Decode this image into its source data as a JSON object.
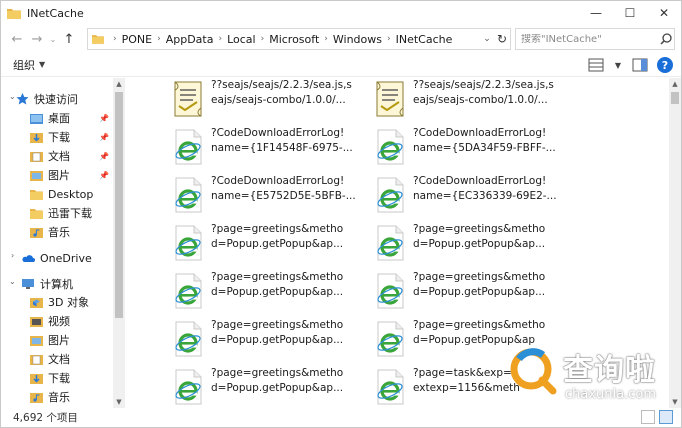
{
  "window": {
    "title": "INetCache"
  },
  "address": {
    "crumbs": [
      "PONE",
      "AppData",
      "Local",
      "Microsoft",
      "Windows",
      "INetCache"
    ]
  },
  "search": {
    "placeholder": "搜索\"INetCache\""
  },
  "toolbar": {
    "organize_label": "组织"
  },
  "nav": {
    "items": [
      {
        "label": "快速访问",
        "icon": "star-icon",
        "pinned": false
      },
      {
        "label": "桌面",
        "icon": "desktop-folder-icon",
        "pinned": true
      },
      {
        "label": "下载",
        "icon": "download-folder-icon",
        "pinned": true
      },
      {
        "label": "文档",
        "icon": "documents-folder-icon",
        "pinned": true
      },
      {
        "label": "图片",
        "icon": "pictures-folder-icon",
        "pinned": true
      },
      {
        "label": "Desktop",
        "icon": "folder-icon",
        "pinned": false
      },
      {
        "label": "迅雷下载",
        "icon": "folder-icon",
        "pinned": false
      },
      {
        "label": "音乐",
        "icon": "music-folder-icon",
        "pinned": false
      },
      {
        "label": "OneDrive",
        "icon": "cloud-icon",
        "pinned": false
      },
      {
        "label": "计算机",
        "icon": "computer-icon",
        "pinned": false
      },
      {
        "label": "3D 对象",
        "icon": "3d-objects-icon",
        "pinned": false
      },
      {
        "label": "视频",
        "icon": "videos-folder-icon",
        "pinned": false
      },
      {
        "label": "图片",
        "icon": "pictures-folder-icon",
        "pinned": false
      },
      {
        "label": "文档",
        "icon": "documents-folder-icon",
        "pinned": false
      },
      {
        "label": "下载",
        "icon": "download-folder-icon",
        "pinned": false
      },
      {
        "label": "音乐",
        "icon": "music-folder-icon",
        "pinned": false
      }
    ]
  },
  "files": [
    {
      "name": "??seajs/seajs/2.2.3/sea.js,s\neajs/seajs-combo/1.0.0/...",
      "icon": "script-file-icon"
    },
    {
      "name": "??seajs/seajs/2.2.3/sea.js,s\neajs/seajs-combo/1.0.0/...",
      "icon": "script-file-icon"
    },
    {
      "name": "?CodeDownloadErrorLog!\nname={1F14548F-6975-...",
      "icon": "ie-file-icon"
    },
    {
      "name": "?CodeDownloadErrorLog!\nname={5DA34F59-FBFF-...",
      "icon": "ie-file-icon"
    },
    {
      "name": "?CodeDownloadErrorLog!\nname={E5752D5E-5BFB-...",
      "icon": "ie-file-icon"
    },
    {
      "name": "?CodeDownloadErrorLog!\nname={EC336339-69E2-...",
      "icon": "ie-file-icon"
    },
    {
      "name": "?page=greetings&metho\nd=Popup.getPopup&ap...",
      "icon": "ie-file-icon"
    },
    {
      "name": "?page=greetings&metho\nd=Popup.getPopup&ap...",
      "icon": "ie-file-icon"
    },
    {
      "name": "?page=greetings&metho\nd=Popup.getPopup&ap...",
      "icon": "ie-file-icon"
    },
    {
      "name": "?page=greetings&metho\nd=Popup.getPopup&ap...",
      "icon": "ie-file-icon"
    },
    {
      "name": "?page=greetings&metho\nd=Popup.getPopup&ap...",
      "icon": "ie-file-icon"
    },
    {
      "name": "?page=greetings&metho\nd=Popup.getPopup&ap",
      "icon": "ie-file-icon"
    },
    {
      "name": "?page=greetings&metho\nd=Popup.getPopup&ap...",
      "icon": "ie-file-icon"
    },
    {
      "name": "?page=task&exp=1\nextexp=1156&meth",
      "icon": "ie-file-icon"
    }
  ],
  "status": {
    "item_count": "4,692 个项目"
  },
  "watermark": {
    "brand_cn": "查询啦",
    "brand_en": "chaxunla.com"
  },
  "colors": {
    "accent": "#1a6ed8",
    "folder": "#e8b54a",
    "ie_blue": "#2a8fd6",
    "ie_green": "#3aa53a"
  }
}
